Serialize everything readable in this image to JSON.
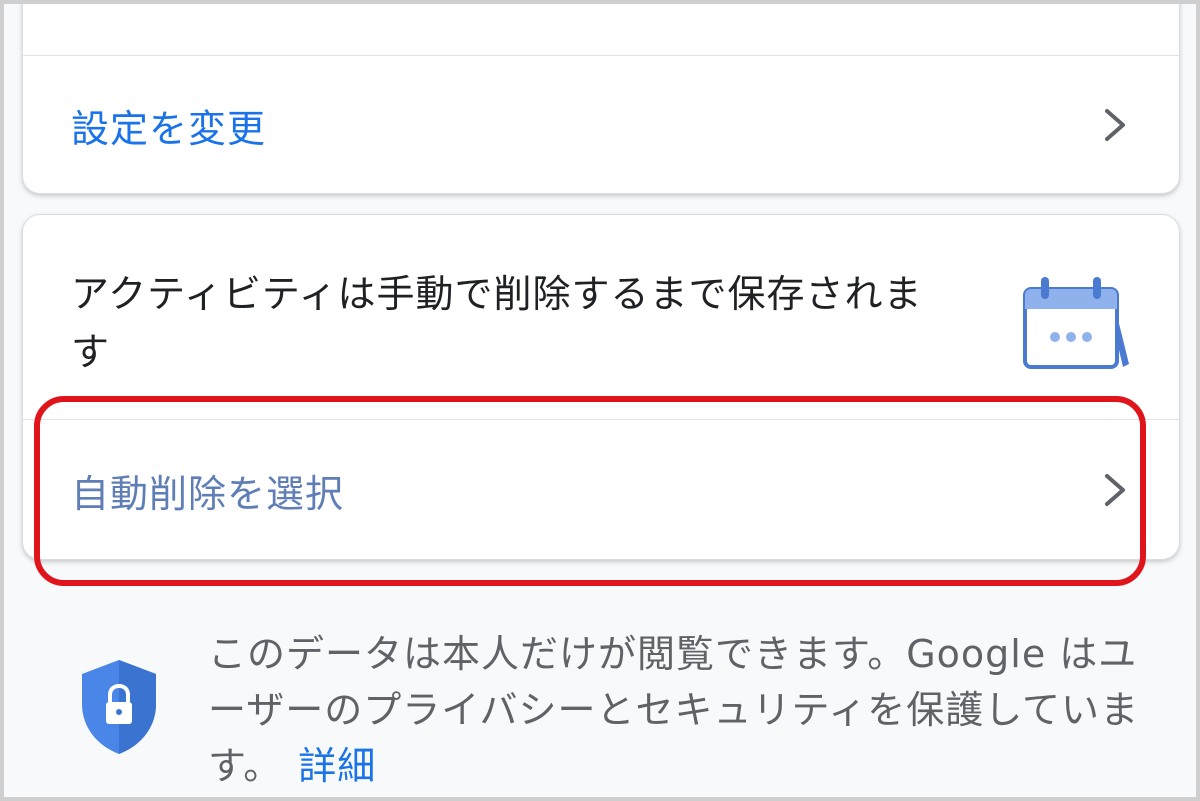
{
  "settings_card": {
    "change_settings_label": "設定を変更"
  },
  "activity_card": {
    "info_text": "アクティビティは手動で削除するまで保存されます",
    "auto_delete_label": "自動削除を選択"
  },
  "privacy": {
    "text": "このデータは本人だけが閲覧できます。Google はユーザーのプライバシーとセキュリティを保護しています。",
    "details_link": "詳細"
  },
  "icons": {
    "calendar": "calendar-icon",
    "shield": "shield-lock-icon",
    "chevron": "chevron-right-icon"
  },
  "colors": {
    "link_blue": "#1a73e8",
    "highlight_red": "#e0141b",
    "text_dark": "#202124",
    "text_gray": "#5f6368"
  }
}
